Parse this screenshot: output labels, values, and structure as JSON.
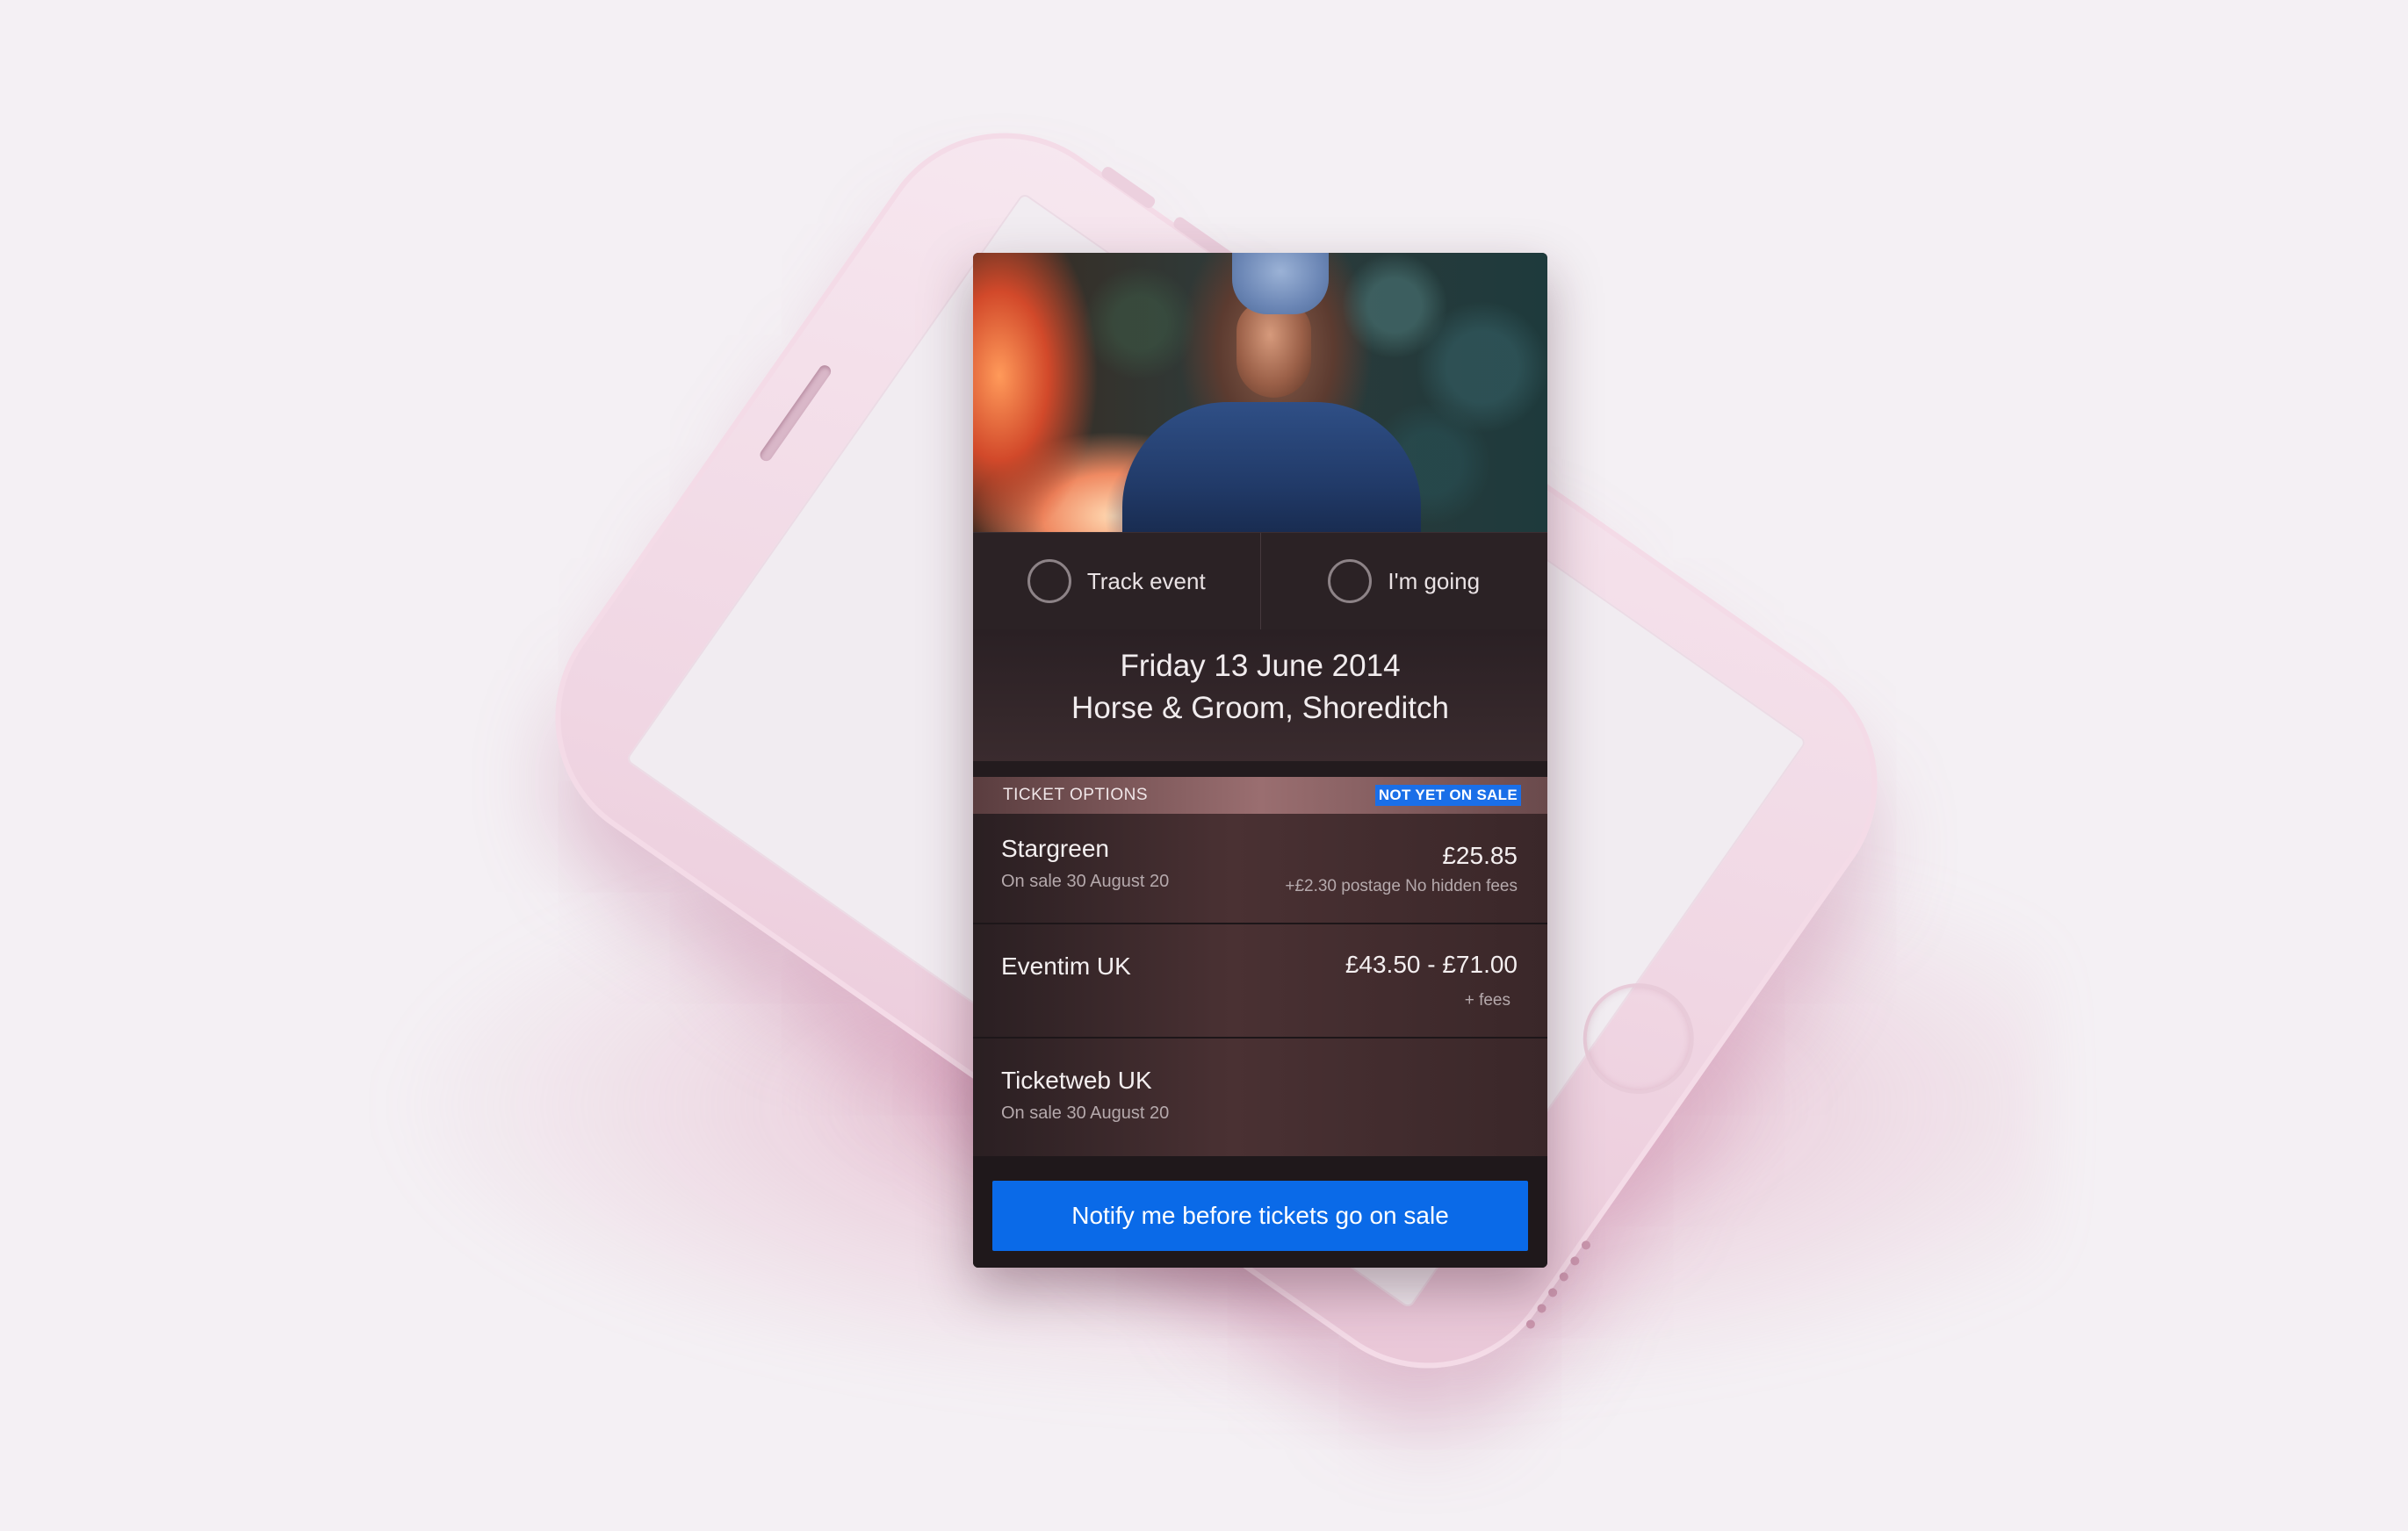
{
  "actions": {
    "track_label": "Track event",
    "going_label": "I'm going"
  },
  "event": {
    "date": "Friday 13 June 2014",
    "venue": "Horse & Groom, Shoreditch"
  },
  "ticket_section": {
    "label": "TICKET OPTIONS",
    "status_badge": "NOT YET ON SALE"
  },
  "tickets": [
    {
      "vendor": "Stargreen",
      "sale_info": "On sale 30 August 20",
      "price": "£25.85",
      "fees": "+£2.30 postage No hidden fees"
    },
    {
      "vendor": "Eventim UK",
      "sale_info": "",
      "price": "£43.50 - £71.00",
      "fees": "+ fees"
    },
    {
      "vendor": "Ticketweb UK",
      "sale_info": "On sale 30 August 20",
      "price": "",
      "fees": ""
    }
  ],
  "cta": {
    "label": "Notify me before tickets go on sale"
  },
  "colors": {
    "accent": "#0a6ae8",
    "background": "#f4f0f4",
    "card": "#231b1e",
    "phone_mockup": "#f0d6e3"
  }
}
